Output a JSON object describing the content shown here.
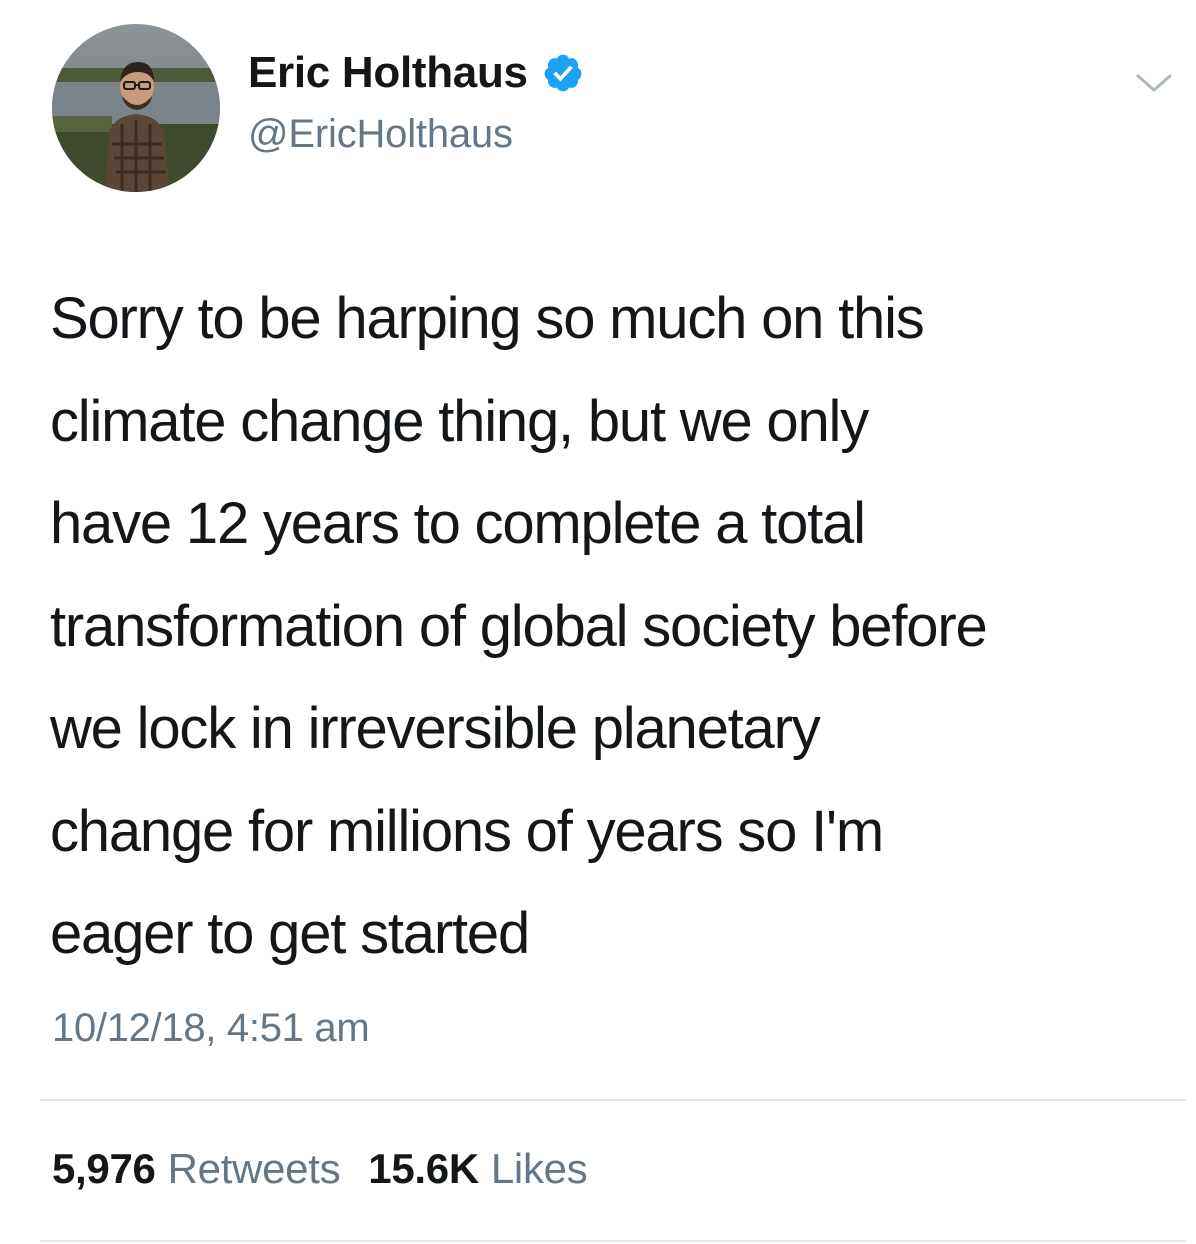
{
  "author": {
    "display_name": "Eric Holthaus",
    "handle": "@EricHolthaus",
    "verified": true
  },
  "tweet": {
    "lines": [
      "Sorry to be harping so much on this",
      "climate change thing, but we only",
      "have 12 years to complete a total",
      "transformation of global society before",
      "we lock in irreversible planetary",
      "change for millions of years so I'm",
      "eager to get started"
    ],
    "timestamp": "10/12/18, 4:51 am"
  },
  "stats": {
    "retweets_count": "5,976",
    "retweets_label": "Retweets",
    "likes_count": "15.6K",
    "likes_label": "Likes"
  },
  "colors": {
    "text": "#14171a",
    "secondary": "#657786",
    "verified_blue": "#1da1f2",
    "divider": "#e1e8ed"
  },
  "icons": {
    "verified": "verified-badge-icon",
    "menu": "chevron-down-icon"
  }
}
